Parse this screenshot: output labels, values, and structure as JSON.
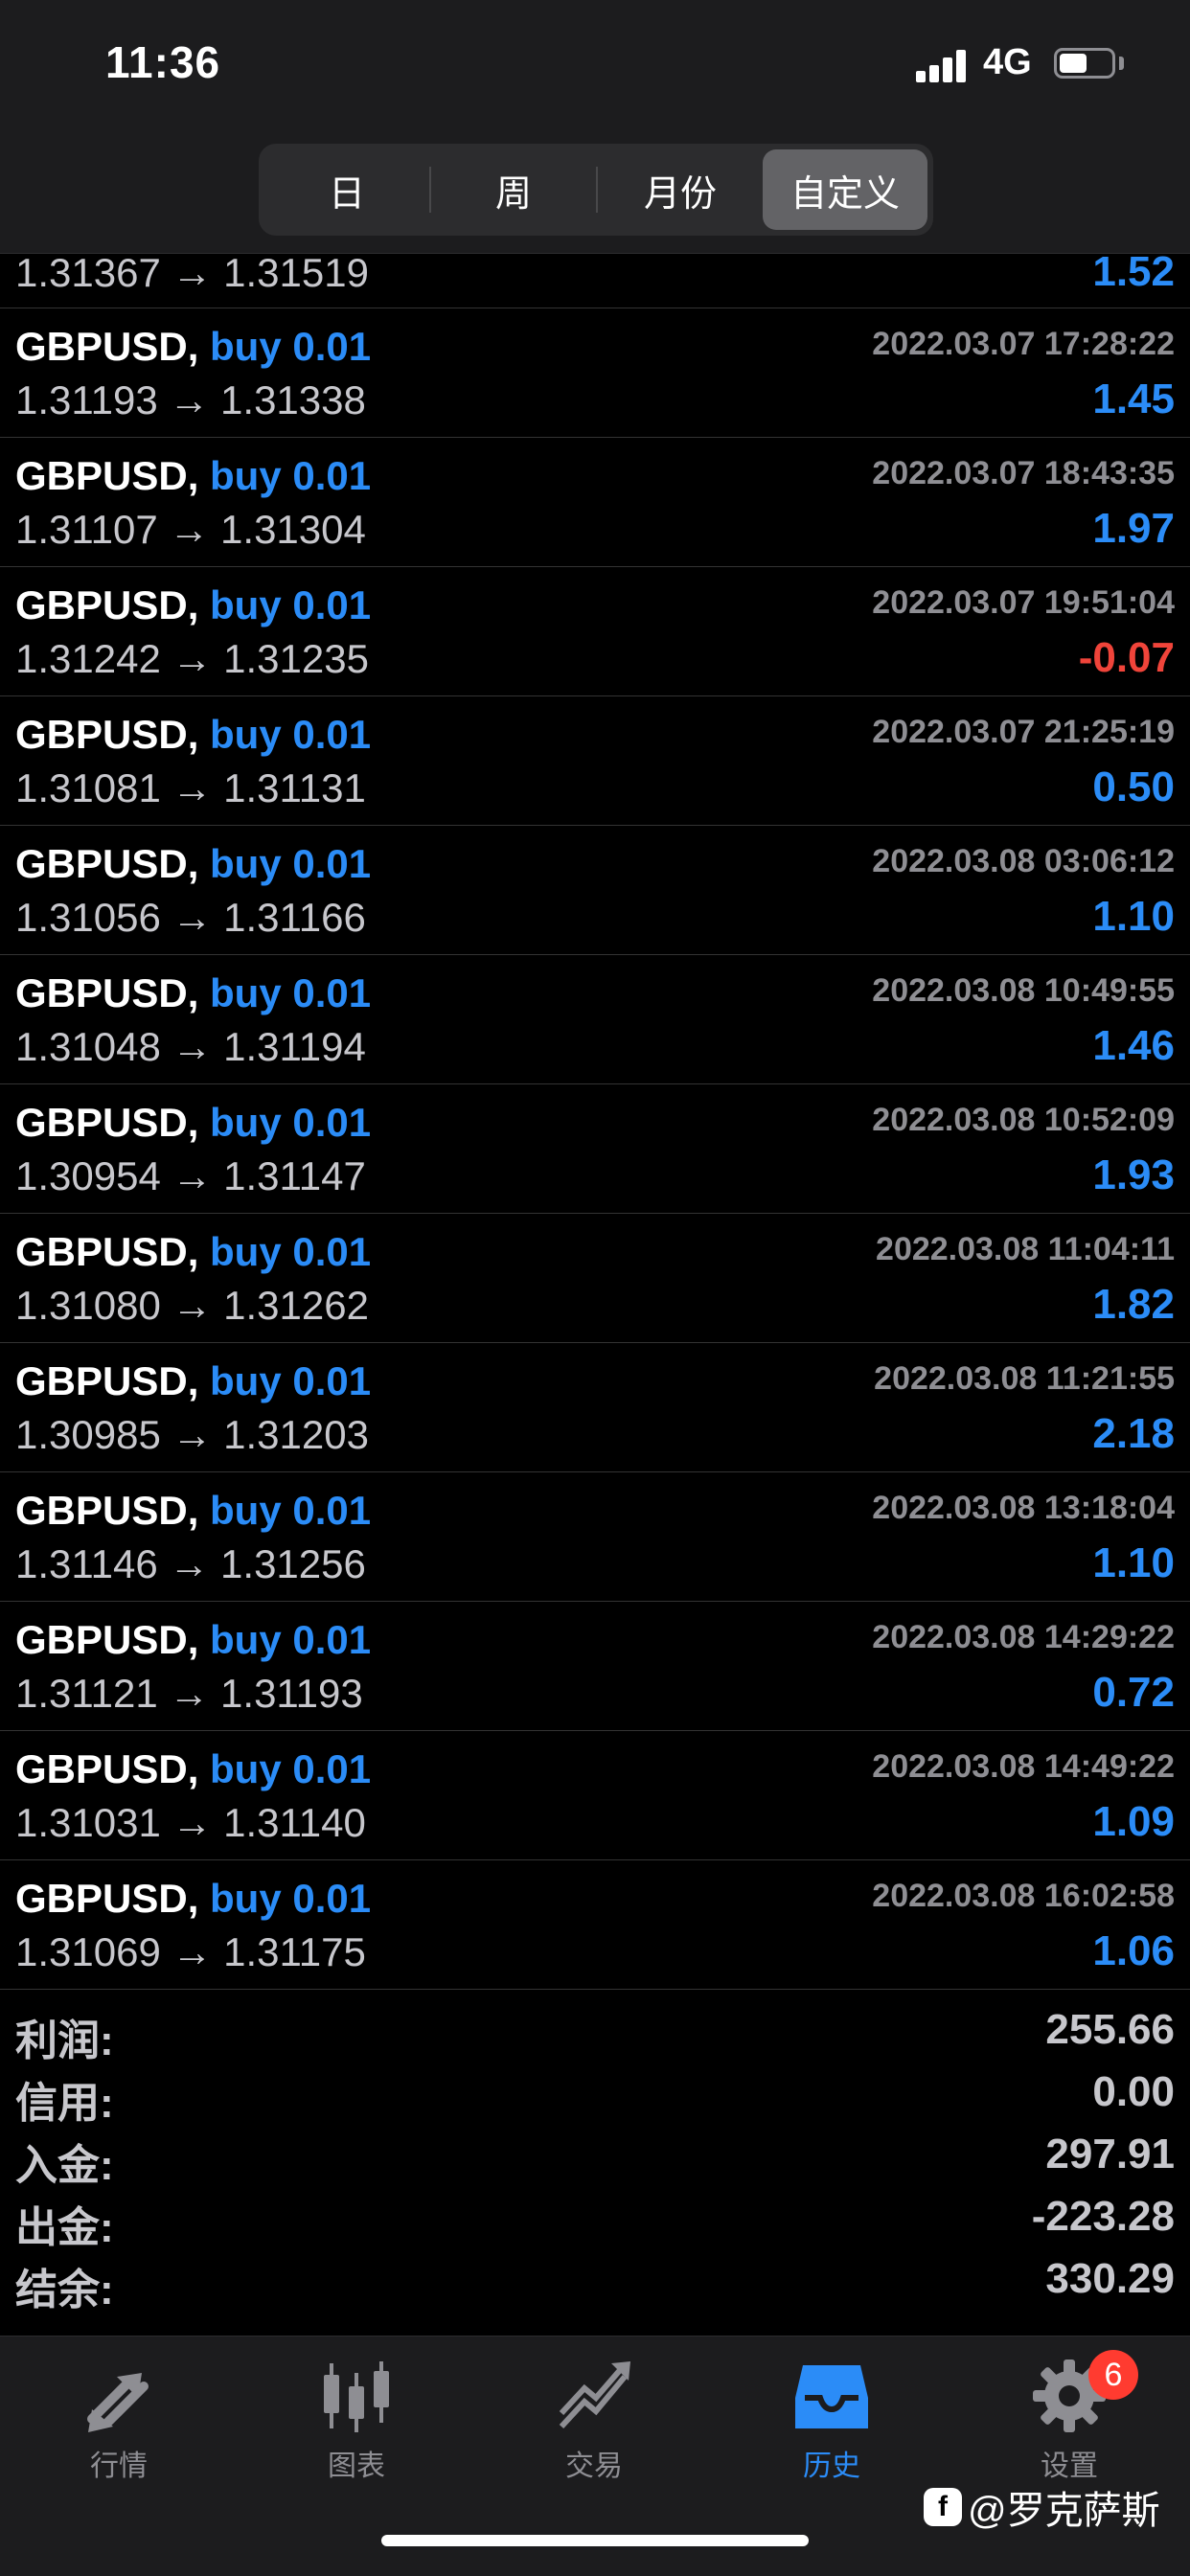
{
  "status_bar": {
    "time": "11:36",
    "network": "4G"
  },
  "segments": [
    {
      "label": "日",
      "active": false
    },
    {
      "label": "周",
      "active": false
    },
    {
      "label": "月份",
      "active": false
    },
    {
      "label": "自定义",
      "active": true
    }
  ],
  "partial_row": {
    "prices": "1.31367 → 1.31519",
    "pnl": "1.52"
  },
  "trades": [
    {
      "symbol": "GBPUSD,",
      "side": "buy 0.01",
      "time": "2022.03.07 17:28:22",
      "prices": "1.31193 → 1.31338",
      "pnl": "1.45"
    },
    {
      "symbol": "GBPUSD,",
      "side": "buy 0.01",
      "time": "2022.03.07 18:43:35",
      "prices": "1.31107 → 1.31304",
      "pnl": "1.97"
    },
    {
      "symbol": "GBPUSD,",
      "side": "buy 0.01",
      "time": "2022.03.07 19:51:04",
      "prices": "1.31242 → 1.31235",
      "pnl": "-0.07"
    },
    {
      "symbol": "GBPUSD,",
      "side": "buy 0.01",
      "time": "2022.03.07 21:25:19",
      "prices": "1.31081 → 1.31131",
      "pnl": "0.50"
    },
    {
      "symbol": "GBPUSD,",
      "side": "buy 0.01",
      "time": "2022.03.08 03:06:12",
      "prices": "1.31056 → 1.31166",
      "pnl": "1.10"
    },
    {
      "symbol": "GBPUSD,",
      "side": "buy 0.01",
      "time": "2022.03.08 10:49:55",
      "prices": "1.31048 → 1.31194",
      "pnl": "1.46"
    },
    {
      "symbol": "GBPUSD,",
      "side": "buy 0.01",
      "time": "2022.03.08 10:52:09",
      "prices": "1.30954 → 1.31147",
      "pnl": "1.93"
    },
    {
      "symbol": "GBPUSD,",
      "side": "buy 0.01",
      "time": "2022.03.08 11:04:11",
      "prices": "1.31080 → 1.31262",
      "pnl": "1.82"
    },
    {
      "symbol": "GBPUSD,",
      "side": "buy 0.01",
      "time": "2022.03.08 11:21:55",
      "prices": "1.30985 → 1.31203",
      "pnl": "2.18"
    },
    {
      "symbol": "GBPUSD,",
      "side": "buy 0.01",
      "time": "2022.03.08 13:18:04",
      "prices": "1.31146 → 1.31256",
      "pnl": "1.10"
    },
    {
      "symbol": "GBPUSD,",
      "side": "buy 0.01",
      "time": "2022.03.08 14:29:22",
      "prices": "1.31121 → 1.31193",
      "pnl": "0.72"
    },
    {
      "symbol": "GBPUSD,",
      "side": "buy 0.01",
      "time": "2022.03.08 14:49:22",
      "prices": "1.31031 → 1.31140",
      "pnl": "1.09"
    },
    {
      "symbol": "GBPUSD,",
      "side": "buy 0.01",
      "time": "2022.03.08 16:02:58",
      "prices": "1.31069 → 1.31175",
      "pnl": "1.06"
    }
  ],
  "summary": [
    {
      "label": "利润:",
      "value": "255.66"
    },
    {
      "label": "信用:",
      "value": "0.00"
    },
    {
      "label": "入金:",
      "value": "297.91"
    },
    {
      "label": "出金:",
      "value": "-223.28"
    },
    {
      "label": "结余:",
      "value": "330.29"
    }
  ],
  "tabs": [
    {
      "label": "行情",
      "icon": "quotes-arrows-icon",
      "active": false
    },
    {
      "label": "图表",
      "icon": "candlestick-icon",
      "active": false
    },
    {
      "label": "交易",
      "icon": "trade-chart-icon",
      "active": false
    },
    {
      "label": "历史",
      "icon": "inbox-icon",
      "active": true
    },
    {
      "label": "设置",
      "icon": "gear-icon",
      "active": false,
      "badge": "6"
    }
  ],
  "watermark": {
    "logo": "f",
    "text": "@罗克萨斯"
  },
  "colors": {
    "accent": "#2b8cf7",
    "negative": "#f0443a",
    "muted": "#8e8e93"
  }
}
